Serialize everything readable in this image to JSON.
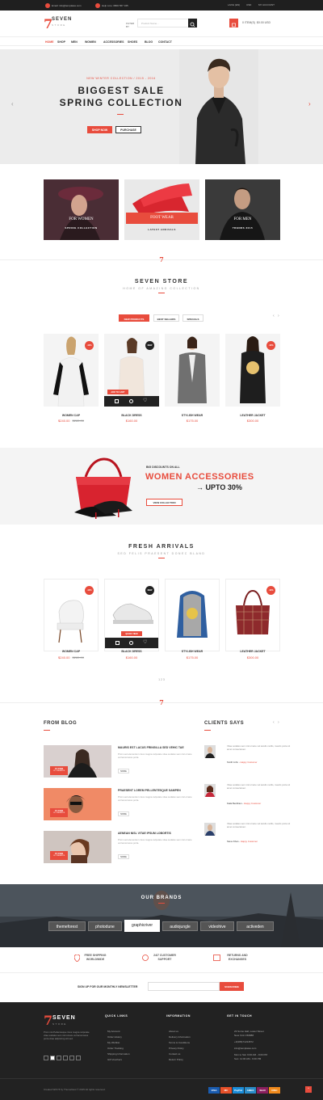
{
  "topbar": {
    "email": "Email: info@templates.com",
    "help": "Help Line: 0800 567 345",
    "lang": "LANG (EN)",
    "currency": "USD",
    "account": "MY ACCOUNT"
  },
  "header": {
    "logo_num": "7",
    "logo_name": "SEVEN",
    "logo_sub": "STORE",
    "filter": "FILTER BY",
    "search_placeholder": "Product Name...",
    "cart_items": "0 ITEM(S)",
    "cart_total": "$0.00 USD"
  },
  "nav": [
    "HOME",
    "SHOP",
    "MEN",
    "WOMEN",
    "ACCESSORIES",
    "SHOES",
    "BLOG",
    "CONTACT"
  ],
  "hero": {
    "kicker": "NEW WINTER COLLECTION  /  2015  -  2016",
    "title1": "Biggest Sale",
    "title2": "Spring Collection",
    "btn_shop": "SHOP NOW",
    "btn_purchase": "PURCHASE"
  },
  "categories": [
    {
      "label": "FOR WOMEN",
      "sub": "SPRING COLLECTION"
    },
    {
      "label": "FOOT WEAR",
      "sub": "LATEST ARRIVALS"
    },
    {
      "label": "FOR MEN",
      "sub": "TRENDS 2015"
    }
  ],
  "store": {
    "mark": "7",
    "title": "SEVEN STORE",
    "subtitle": "HOME OF AMAZING COLLECTION",
    "tabs": [
      "NEW PRODUCTS",
      "BEST SELLERS",
      "SPECIALS"
    ]
  },
  "products": [
    {
      "name": "WOMEN CAP",
      "price": "$240.00",
      "old": "$280.00",
      "badge": "-10%"
    },
    {
      "name": "BLACK DRESS",
      "price": "$160.00",
      "old": "",
      "badge": "NEW",
      "cart": "ADD TO CART"
    },
    {
      "name": "STYLISH WEAR",
      "price": "$175.00",
      "old": "",
      "badge": ""
    },
    {
      "name": "LEATHER JACKET",
      "price": "$300.00",
      "old": "",
      "badge": "-10%"
    }
  ],
  "promo": {
    "kicker": "BIG DISCOUNTS ON ALL",
    "title": "WOMEN ACCESSORIES",
    "subtitle": "→ UPTO 30%",
    "btn": "VIEW COLLECTION"
  },
  "fresh": {
    "title": "FRESH ARRIVALS",
    "subtitle": "SED FELIS PRAESENT DONEC BLAND"
  },
  "fresh_products": [
    {
      "name": "WOMEN CAP",
      "price": "$240.00",
      "old": "$280.00",
      "badge": "-10%"
    },
    {
      "name": "BLACK DRESS",
      "price": "$160.00",
      "old": "",
      "badge": "NEW",
      "cart": "QUICK VIEW"
    },
    {
      "name": "STYLISH WEAR",
      "price": "$175.00",
      "old": "",
      "badge": ""
    },
    {
      "name": "LEATHER JACKET",
      "price": "$300.00",
      "old": "",
      "badge": "-10%"
    }
  ],
  "pager": "1 2 3",
  "blog": {
    "title": "FROM BLOG",
    "posts": [
      {
        "title": "MAURIS EST LACUS FRINGILLA SED VEHIC TAE",
        "text": "Proin sed elementum risus magna vulputate vitae sodales sem nisl ornare vel lacus lacus porta.",
        "date": "15 FEB",
        "comments": "15 COMMENTS",
        "more": "MORE"
      },
      {
        "title": "PRAESENT LOREM PELLENTESQUE SAMPEN",
        "text": "Proin sed elementum risus magna vulputate vitae sodales sem nisl ornare vel lacus lacus porta.",
        "date": "15 FEB",
        "comments": "15 COMMENTS",
        "more": "MORE"
      },
      {
        "title": "AENEAN NISL VITAE IPSUM LOBORTIS",
        "text": "Proin sed elementum risus magna vulputate vitae sodales sem nisl ornare vel lacus lacus porta.",
        "date": "15 FEB",
        "comments": "15 COMMENTS",
        "more": "MORE"
      }
    ]
  },
  "clients": {
    "title": "CLIENTS SAYS",
    "items": [
      {
        "text": "Vitae sodales sem nisl ornare vel iaculis mollis, mauris porta sit amet consectetuer.",
        "name": "Smith John",
        "role": "Happy Customer"
      },
      {
        "text": "Vitae sodales sem nisl ornare vel iaculis mollis, mauris porta sit amet consectetuer.",
        "name": "Kaila Beckham",
        "role": "Happy Customer"
      },
      {
        "text": "Vitae sodales sem nisl ornare vel iaculis mollis, mauris porta sit amet consectetuer.",
        "name": "Steve Khan",
        "role": "Happy Customer"
      }
    ]
  },
  "brands": {
    "title": "OUR BRANDS",
    "items": [
      "themeforest",
      "photodune",
      "graphicriver",
      "audiojungle",
      "videohive",
      "activeden"
    ]
  },
  "features": [
    {
      "line1": "FREE SHIPPING",
      "line2": "WORLDWIDE"
    },
    {
      "line1": "24/7 CUSTOMER",
      "line2": "SUPPORT"
    },
    {
      "line1": "RETURNS AND",
      "line2": "EXCHANGES"
    }
  ],
  "newsletter": {
    "label": "SIGN UP FOR OUR MONTHLY NEWSLETTER",
    "button": "SUBSCRIBE"
  },
  "footer": {
    "about": "Proin nisi Pellentesque risus magna vulputate vitae sodales sem nisl ornare vel lacus lacus porta vitae adipiscing elit sed.",
    "quick_title": "QUICK LINKS",
    "quick": [
      "My Account",
      "Order History",
      "My Wishlist",
      "Order Tracking",
      "Shipping Information",
      "Gift Vouchers"
    ],
    "info_title": "INFORMATION",
    "info": [
      "About us",
      "Delivery Information",
      "Terms & Conditions",
      "Privacy Policy",
      "Contact us",
      "Return Policy"
    ],
    "touch_title": "GET IN TOUCH",
    "touch": [
      "23 Some Hall, Lower Street",
      "New York C56888",
      "+0(386)71234572",
      "info@templates.com",
      "Mon to Sat: 9:00 AM - 9:00 PM",
      "Sun: 11:00 AM - 6:00 PM"
    ],
    "copyright": "Created With ♥ by ThemeNest © 2015 All rights reserved.",
    "payments": [
      "VISA",
      "MC",
      "PayPal",
      "AMEX",
      "Skrill",
      "DISC"
    ]
  },
  "colors": {
    "accent": "#e84c3d",
    "dark": "#222222"
  }
}
